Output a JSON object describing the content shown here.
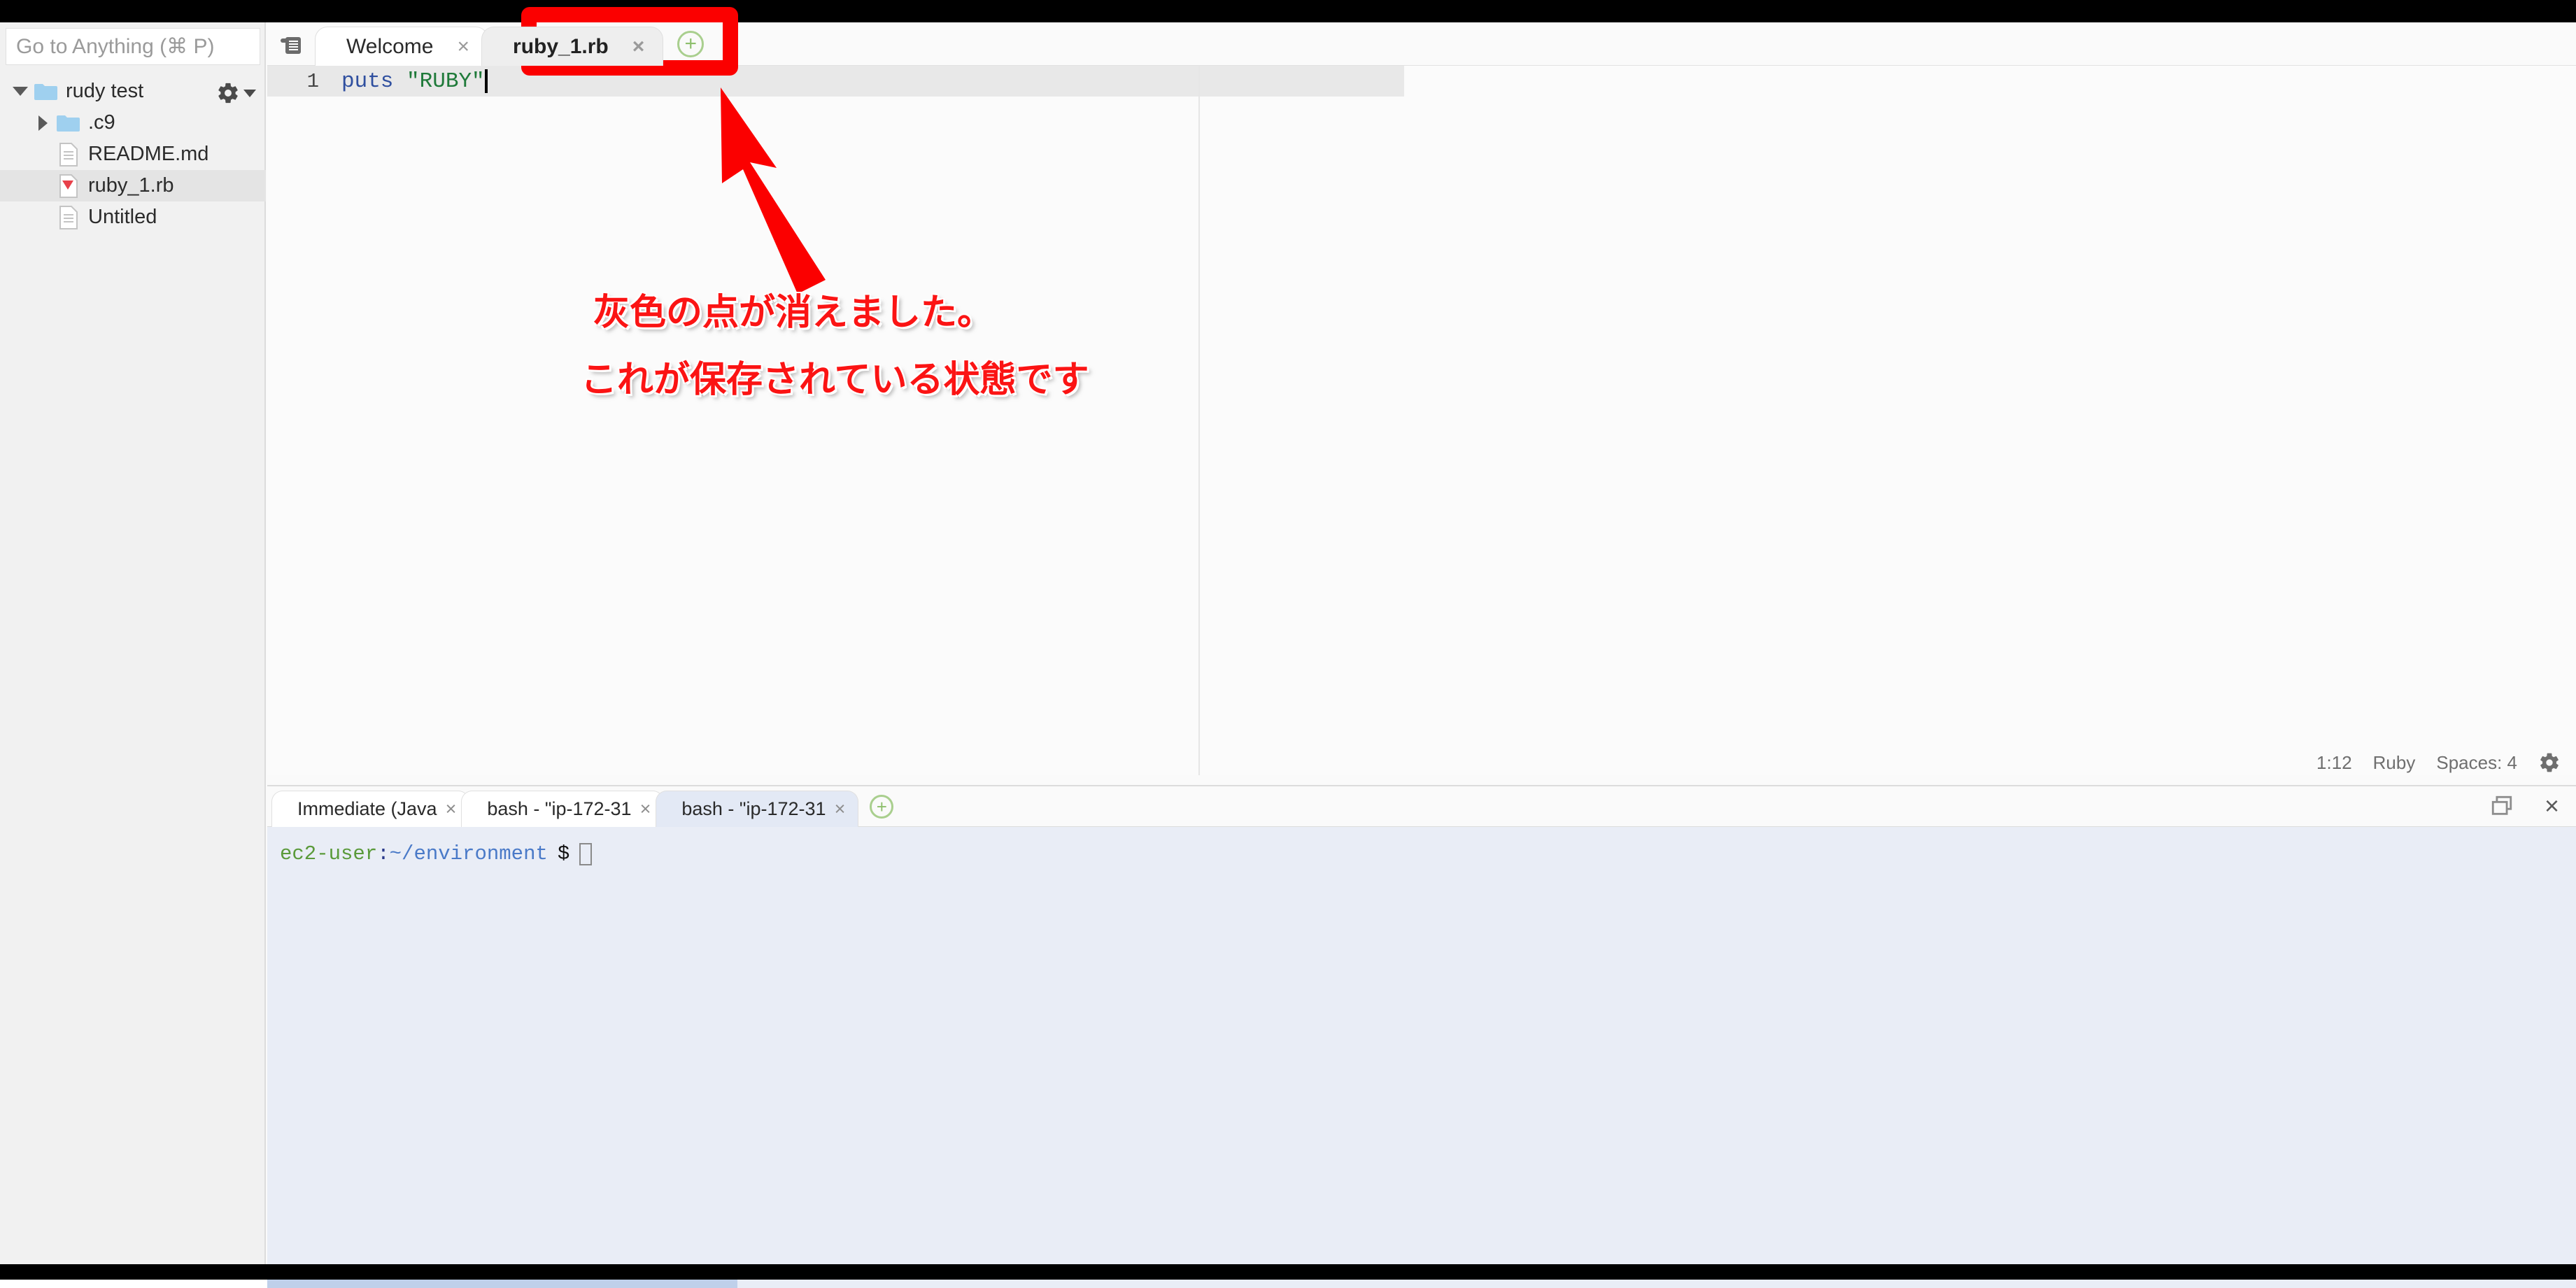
{
  "window": {
    "top_strip_color": "#000000",
    "bottom_strip_color": "#000000"
  },
  "sidebar": {
    "search": {
      "placeholder": "Go to Anything (⌘ P)",
      "value": ""
    },
    "gear_menu_label": "gear-dropdown",
    "tree": [
      {
        "label": "rudy test",
        "type": "folder",
        "depth": 0,
        "expanded": true,
        "selected": false
      },
      {
        "label": ".c9",
        "type": "folder",
        "depth": 1,
        "expanded": false,
        "selected": false
      },
      {
        "label": "README.md",
        "type": "file",
        "depth": 1,
        "expanded": null,
        "selected": false
      },
      {
        "label": "ruby_1.rb",
        "type": "ruby",
        "depth": 1,
        "expanded": null,
        "selected": true
      },
      {
        "label": "Untitled",
        "type": "file",
        "depth": 1,
        "expanded": null,
        "selected": false
      }
    ]
  },
  "editor": {
    "tabs": [
      {
        "label": "Welcome",
        "active": false,
        "close_label": "×"
      },
      {
        "label": "ruby_1.rb",
        "active": true,
        "close_label": "×"
      }
    ],
    "new_tab_label": "+",
    "panel_icon": "tab-list-icon",
    "line_number": "1",
    "code": {
      "keyword": "puts",
      "space": " ",
      "string": "\"RUBY\""
    }
  },
  "statusbar": {
    "cursor_position": "1:12",
    "language": "Ruby",
    "indent": "Spaces: 4",
    "settings_label": "editor-settings"
  },
  "console": {
    "tabs": [
      {
        "label": "Immediate (Java",
        "active": false,
        "close_label": "×"
      },
      {
        "label": "bash - \"ip-172-31",
        "active": false,
        "close_label": "×"
      },
      {
        "label": "bash - \"ip-172-31",
        "active": true,
        "close_label": "×"
      }
    ],
    "new_tab_label": "+",
    "maximize_label": "maximize-panel",
    "close_label": "×",
    "terminal": {
      "user": "ec2-user",
      "colon": ":",
      "path": "~/environment",
      "prompt_symbol": "$"
    }
  },
  "annotation": {
    "accent_color": "#fb0000",
    "line1": "灰色の点が消えました。",
    "line2": "これが保存されている状態です",
    "highlight_target": "ruby_1.rb tab",
    "arrow_label": "red-arrow-pointing-to-tab"
  }
}
